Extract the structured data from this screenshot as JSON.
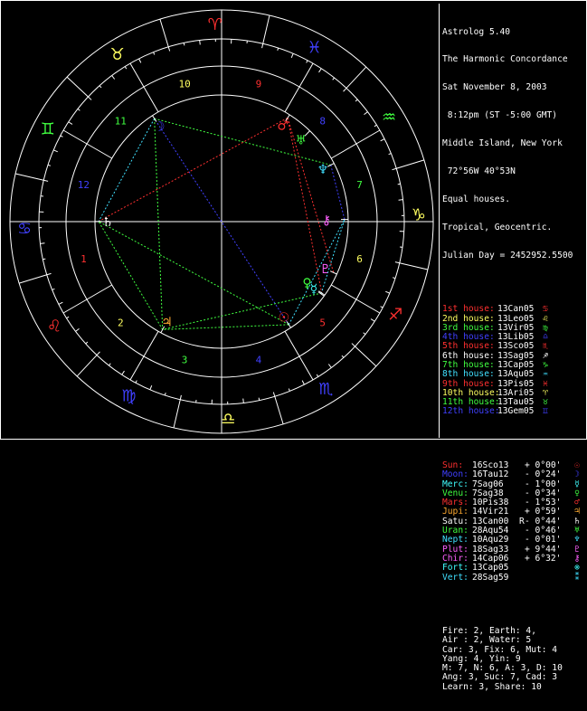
{
  "header": {
    "program": "Astrolog 5.40",
    "chart_name": "The Harmonic Concordance",
    "date": "Sat November 8, 2003",
    "time": "8:12pm (ST -5:00 GMT)",
    "place": "Middle Island, New York",
    "coords": "72°56W 40°53N",
    "house_system": "Equal houses.",
    "zodiac": "Tropical, Geocentric.",
    "julian_day": "Julian Day = 2452952.5500"
  },
  "houses": [
    {
      "label": "1st house:",
      "pos": "13Can05",
      "glyph": "♋",
      "color": "#ff3030"
    },
    {
      "label": "2nd house:",
      "pos": "13Leo05",
      "glyph": "♌",
      "color": "#ffff60"
    },
    {
      "label": "3rd house:",
      "pos": "13Vir05",
      "glyph": "♍",
      "color": "#40ff40"
    },
    {
      "label": "4th house:",
      "pos": "13Lib05",
      "glyph": "♎",
      "color": "#4040ff"
    },
    {
      "label": "5th house:",
      "pos": "13Sco05",
      "glyph": "♏",
      "color": "#ff3030"
    },
    {
      "label": "6th house:",
      "pos": "13Sag05",
      "glyph": "♐",
      "color": "#ffffff"
    },
    {
      "label": "7th house:",
      "pos": "13Cap05",
      "glyph": "♑",
      "color": "#40ff40"
    },
    {
      "label": "8th house:",
      "pos": "13Aqu05",
      "glyph": "♒",
      "color": "#40e0ff"
    },
    {
      "label": "9th house:",
      "pos": "13Pis05",
      "glyph": "♓",
      "color": "#ff3030"
    },
    {
      "label": "10th house:",
      "pos": "13Ari05",
      "glyph": "♈",
      "color": "#ffff60"
    },
    {
      "label": "11th house:",
      "pos": "13Tau05",
      "glyph": "♉",
      "color": "#40ff40"
    },
    {
      "label": "12th house:",
      "pos": "13Gem05",
      "glyph": "♊",
      "color": "#4040ff"
    }
  ],
  "planets": [
    {
      "name": "Sun:",
      "pos": "16Sco13",
      "retro": "",
      "dec": "+ 0°00'",
      "glyph": "☉",
      "color": "#ff3030"
    },
    {
      "name": "Moon:",
      "pos": "16Tau12",
      "retro": "",
      "dec": "- 0°24'",
      "glyph": "☽",
      "color": "#4040ff"
    },
    {
      "name": "Merc:",
      "pos": "7Sag06",
      "retro": "",
      "dec": "- 1°00'",
      "glyph": "☿",
      "color": "#40ffff"
    },
    {
      "name": "Venu:",
      "pos": "7Sag38",
      "retro": "",
      "dec": "- 0°34'",
      "glyph": "♀",
      "color": "#40ff40"
    },
    {
      "name": "Mars:",
      "pos": "10Pis38",
      "retro": "",
      "dec": "- 1°53'",
      "glyph": "♂",
      "color": "#ff3030"
    },
    {
      "name": "Jupi:",
      "pos": "14Vir21",
      "retro": "",
      "dec": "+ 0°59'",
      "glyph": "♃",
      "color": "#ffaa30"
    },
    {
      "name": "Satu:",
      "pos": "13Can00",
      "retro": "R",
      "dec": "- 0°44'",
      "glyph": "♄",
      "color": "#ffffff"
    },
    {
      "name": "Uran:",
      "pos": "28Aqu54",
      "retro": "",
      "dec": "- 0°46'",
      "glyph": "♅",
      "color": "#40ff40"
    },
    {
      "name": "Nept:",
      "pos": "10Aqu29",
      "retro": "",
      "dec": "- 0°01'",
      "glyph": "♆",
      "color": "#40e0ff"
    },
    {
      "name": "Plut:",
      "pos": "18Sag33",
      "retro": "",
      "dec": "+ 9°44'",
      "glyph": "♇",
      "color": "#ff60ff"
    },
    {
      "name": "Chir:",
      "pos": "14Cap06",
      "retro": "",
      "dec": "+ 6°32'",
      "glyph": "⚷",
      "color": "#ff60ff"
    },
    {
      "name": "Fort:",
      "pos": "13Cap05",
      "retro": "",
      "dec": "",
      "glyph": "⊗",
      "color": "#40ffff"
    },
    {
      "name": "Vert:",
      "pos": "28Sag59",
      "retro": "",
      "dec": "",
      "glyph": "⁑",
      "color": "#40e0ff"
    }
  ],
  "summary": [
    "Fire: 2, Earth: 4,",
    "Air : 2, Water: 5",
    "Car: 3, Fix: 6, Mut: 4",
    "Yang: 4, Yin: 9",
    "M: 7, N: 6, A: 3, D: 10",
    "Ang: 3, Suc: 7, Cad: 3",
    "Learn: 3, Share: 10"
  ],
  "wheel": {
    "signs": [
      {
        "glyph": "♋",
        "color": "#4040ff"
      },
      {
        "glyph": "♌",
        "color": "#ff3030"
      },
      {
        "glyph": "♍",
        "color": "#4040ff"
      },
      {
        "glyph": "♎",
        "color": "#ffff60"
      },
      {
        "glyph": "♏",
        "color": "#4040ff"
      },
      {
        "glyph": "♐",
        "color": "#ff3030"
      },
      {
        "glyph": "♑",
        "color": "#ffff60"
      },
      {
        "glyph": "♒",
        "color": "#40ff40"
      },
      {
        "glyph": "♓",
        "color": "#4040ff"
      },
      {
        "glyph": "♈",
        "color": "#ff3030"
      },
      {
        "glyph": "♉",
        "color": "#ffff60"
      },
      {
        "glyph": "♊",
        "color": "#40ff40"
      }
    ],
    "house_numbers": [
      {
        "n": "1",
        "color": "#ff3030"
      },
      {
        "n": "2",
        "color": "#ffff60"
      },
      {
        "n": "3",
        "color": "#40ff40"
      },
      {
        "n": "4",
        "color": "#4040ff"
      },
      {
        "n": "5",
        "color": "#ff3030"
      },
      {
        "n": "6",
        "color": "#ffff60"
      },
      {
        "n": "7",
        "color": "#40ff40"
      },
      {
        "n": "8",
        "color": "#4040ff"
      },
      {
        "n": "9",
        "color": "#ff3030"
      },
      {
        "n": "10",
        "color": "#ffff60"
      },
      {
        "n": "11",
        "color": "#40ff40"
      },
      {
        "n": "12",
        "color": "#4040ff"
      }
    ],
    "planets": [
      {
        "glyph": "☉",
        "color": "#ff3030",
        "lon": 226.2
      },
      {
        "glyph": "☽",
        "color": "#4040ff",
        "lon": 46.2
      },
      {
        "glyph": "☿",
        "color": "#40ffff",
        "lon": 247.1
      },
      {
        "glyph": "♀",
        "color": "#40ff40",
        "lon": 247.6
      },
      {
        "glyph": "♂",
        "color": "#ff3030",
        "lon": 340.6
      },
      {
        "glyph": "♃",
        "color": "#ffaa30",
        "lon": 164.4
      },
      {
        "glyph": "♄",
        "color": "#ffffff",
        "lon": 103.0
      },
      {
        "glyph": "♅",
        "color": "#40ff40",
        "lon": 328.9
      },
      {
        "glyph": "♆",
        "color": "#40e0ff",
        "lon": 310.5
      },
      {
        "glyph": "♇",
        "color": "#ff60ff",
        "lon": 258.6
      },
      {
        "glyph": "⚷",
        "color": "#ff60ff",
        "lon": 284.1
      }
    ],
    "asc_lon": 103.08
  }
}
